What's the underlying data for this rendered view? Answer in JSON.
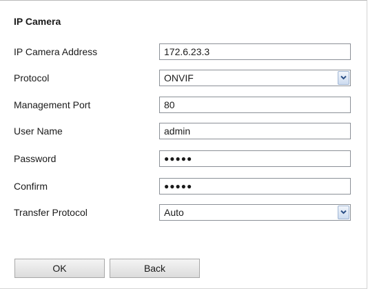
{
  "section_title": "IP Camera",
  "fields": {
    "ip_address": {
      "label": "IP Camera Address",
      "value": "172.6.23.3"
    },
    "protocol": {
      "label": "Protocol",
      "value": "ONVIF"
    },
    "management_port": {
      "label": "Management Port",
      "value": "80"
    },
    "user_name": {
      "label": "User Name",
      "value": "admin"
    },
    "password": {
      "label": "Password",
      "value": "●●●●●"
    },
    "confirm": {
      "label": "Confirm",
      "value": "●●●●●"
    },
    "transfer_protocol": {
      "label": "Transfer Protocol",
      "value": "Auto"
    }
  },
  "buttons": {
    "ok": "OK",
    "back": "Back"
  },
  "icons": {
    "dropdown": "chevron-down-icon"
  },
  "colors": {
    "border": "#8a8f96",
    "dropdown_button": "#cddcf0",
    "dropdown_arrow": "#2b4f86"
  }
}
